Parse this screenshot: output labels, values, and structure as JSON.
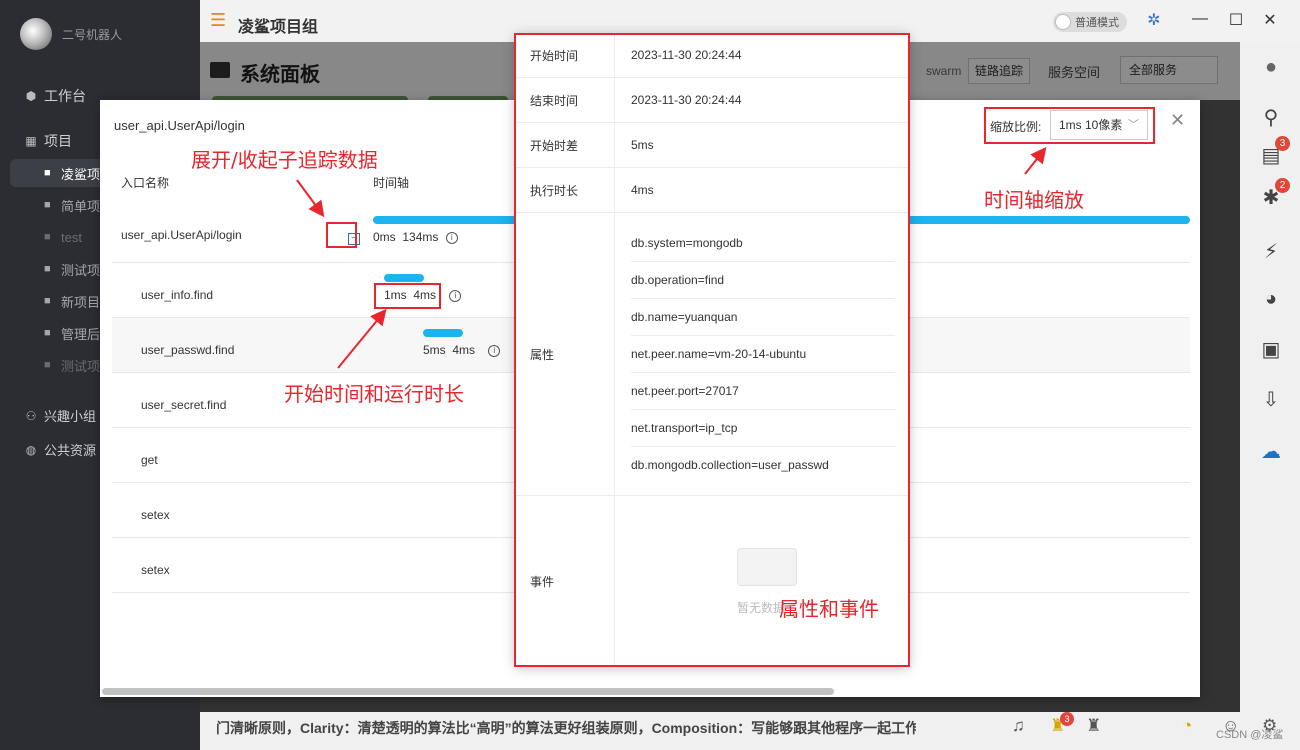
{
  "sidebar": {
    "user_name": "二号机器人",
    "workbench": "工作台",
    "projects": "项目",
    "project_items": [
      "凌鲨项",
      "简单项",
      "test",
      "测试项",
      "新项目",
      "管理后",
      "测试项"
    ],
    "interest_group": "兴趣小组",
    "public_resources": "公共资源"
  },
  "titlebar": {
    "app_title": "凌鲨项目组",
    "mode_label": "普通模式",
    "minimize": "—",
    "maximize": "☐",
    "close": "✕"
  },
  "page_header": {
    "title": "系统面板",
    "swarm": "swarm",
    "trace_button": "链路追踪",
    "service_space_label": "服务空间",
    "service_select": "全部服务"
  },
  "dialog": {
    "title": "user_api.UserApi/login",
    "scale_label": "缩放比例:",
    "scale_value": "1ms 10像素",
    "columns": {
      "entry": "入口名称",
      "timeline": "时间轴"
    },
    "rows": [
      {
        "name": "user_api.UserApi/login",
        "start": "0ms",
        "duration": "134ms"
      },
      {
        "name": "user_info.find",
        "start": "1ms",
        "duration": "4ms"
      },
      {
        "name": "user_passwd.find",
        "start": "5ms",
        "duration": "4ms"
      },
      {
        "name": "user_secret.find"
      },
      {
        "name": "get"
      },
      {
        "name": "setex"
      },
      {
        "name": "setex"
      }
    ]
  },
  "detail": {
    "start_time_label": "开始时间",
    "start_time": "2023-11-30 20:24:44",
    "end_time_label": "结束时间",
    "end_time": "2023-11-30 20:24:44",
    "start_offset_label": "开始时差",
    "start_offset": "5ms",
    "exec_time_label": "执行时长",
    "exec_time": "4ms",
    "attributes_label": "属性",
    "attributes": [
      "db.system=mongodb",
      "db.operation=find",
      "db.name=yuanquan",
      "net.peer.name=vm-20-14-ubuntu",
      "net.peer.port=27017",
      "net.transport=ip_tcp",
      "db.mongodb.collection=user_passwd"
    ],
    "events_label": "事件",
    "empty_text": "暂无数据"
  },
  "annotations": {
    "expand_collapse": "展开/收起子追踪数据",
    "start_and_duration": "开始时间和运行时长",
    "timeline_zoom": "时间轴缩放",
    "attrs_events": "属性和事件"
  },
  "statusbar": {
    "ticker": "门清晰原则，Clarity：清楚透明的算法比“高明”的算法更好组装原则，Composition：写能够跟其他程序一起工作的",
    "badge_count": "3",
    "watermark": "CSDN @凌鲨"
  },
  "right_bar": {
    "badge_doc": "3",
    "badge_bug": "2"
  },
  "colors": {
    "accent": "#1db3ee",
    "annotation": "#e8262d",
    "sidebar_bg": "#2b2d33"
  }
}
